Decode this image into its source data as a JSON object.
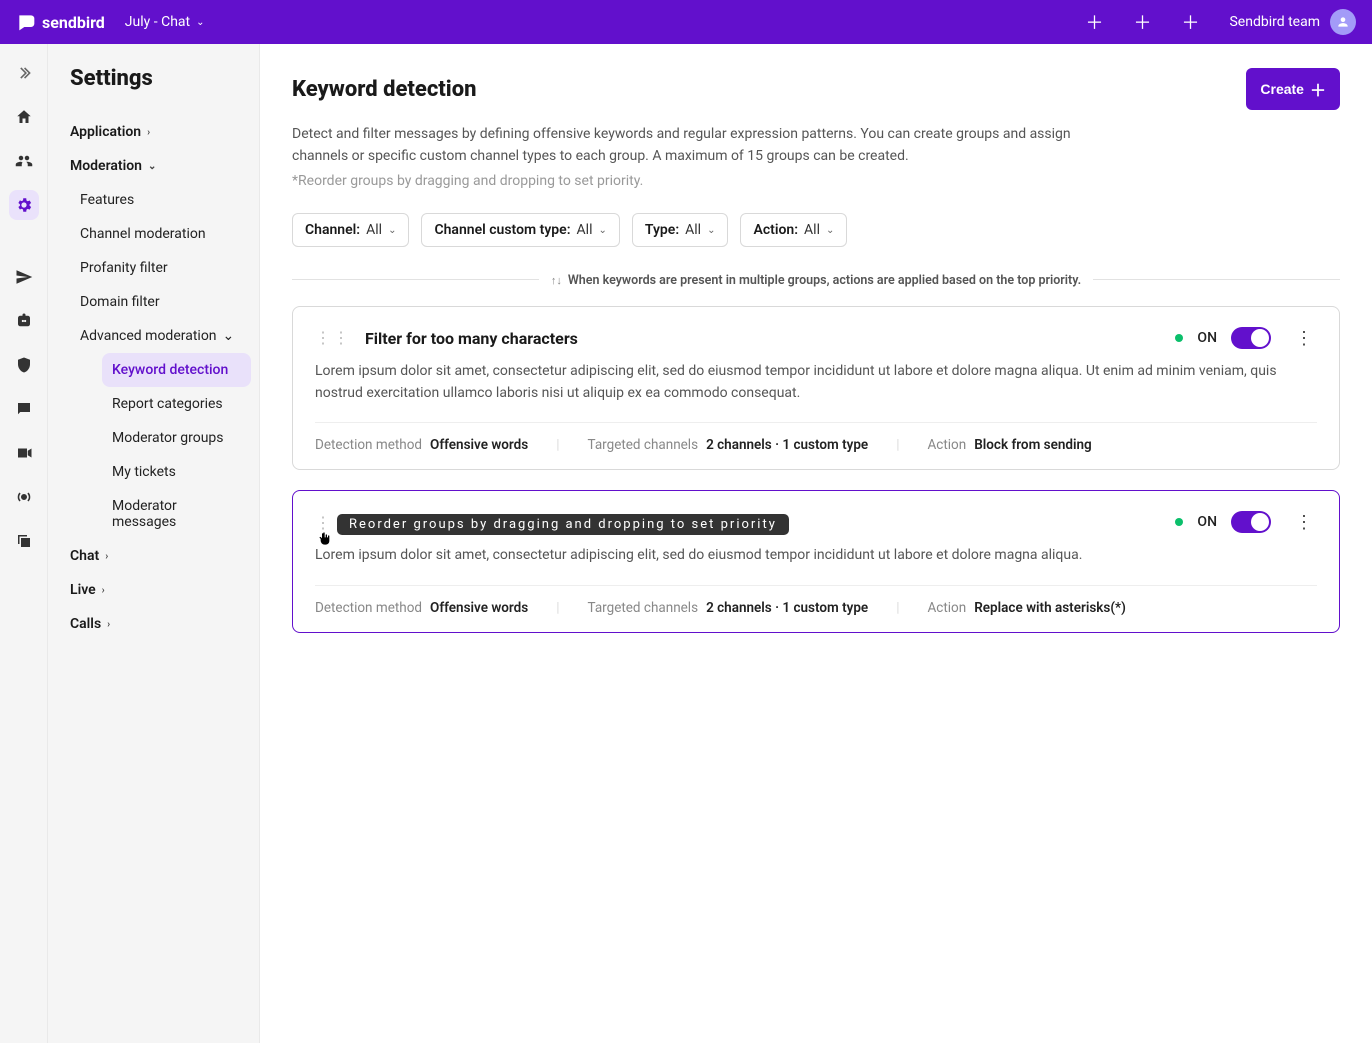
{
  "topbar": {
    "brand": "sendbird",
    "project": "July - Chat",
    "team": "Sendbird team"
  },
  "sidebar": {
    "title": "Settings",
    "sections": {
      "application": "Application",
      "moderation": "Moderation",
      "chat": "Chat",
      "live": "Live",
      "calls": "Calls"
    },
    "moderation_items": {
      "features": "Features",
      "channel_moderation": "Channel moderation",
      "profanity_filter": "Profanity filter",
      "domain_filter": "Domain filter",
      "advanced_moderation": "Advanced moderation"
    },
    "advanced_items": {
      "keyword_detection": "Keyword detection",
      "report_categories": "Report categories",
      "moderator_groups": "Moderator groups",
      "my_tickets": "My tickets",
      "moderator_messages": "Moderator messages"
    }
  },
  "page": {
    "title": "Keyword detection",
    "create_label": "Create",
    "description": "Detect and filter messages by defining offensive keywords and regular expression patterns. You can create groups and assign channels or specific custom channel types to each group. A maximum of 15 groups can be created.",
    "note": "*Reorder groups by dragging and dropping to set priority.",
    "priority_hint": "When keywords are present in multiple groups, actions are applied based on the top priority."
  },
  "filters": {
    "channel": {
      "label": "Channel:",
      "value": "All"
    },
    "custom_type": {
      "label": "Channel custom type:",
      "value": "All"
    },
    "type": {
      "label": "Type:",
      "value": "All"
    },
    "action": {
      "label": "Action:",
      "value": "All"
    }
  },
  "tooltip": "Reorder groups by dragging and dropping to set priority",
  "status_on": "ON",
  "meta_labels": {
    "detection": "Detection method",
    "channels": "Targeted channels",
    "action": "Action"
  },
  "groups": [
    {
      "title": "Filter for too many characters",
      "desc": "Lorem ipsum dolor sit amet, consectetur adipiscing elit, sed do eiusmod tempor incididunt ut labore et dolore magna aliqua. Ut enim ad minim veniam, quis nostrud exercitation ullamco laboris nisi ut aliquip ex ea commodo consequat.",
      "detection": "Offensive words",
      "channels": "2 channels · 1 custom type",
      "action": "Block from sending"
    },
    {
      "title": "",
      "desc": "Lorem ipsum dolor sit amet, consectetur adipiscing elit, sed do eiusmod tempor incididunt ut labore et dolore magna aliqua.",
      "detection": "Offensive words",
      "channels": "2 channels · 1 custom type",
      "action": "Replace with asterisks(*)"
    }
  ]
}
